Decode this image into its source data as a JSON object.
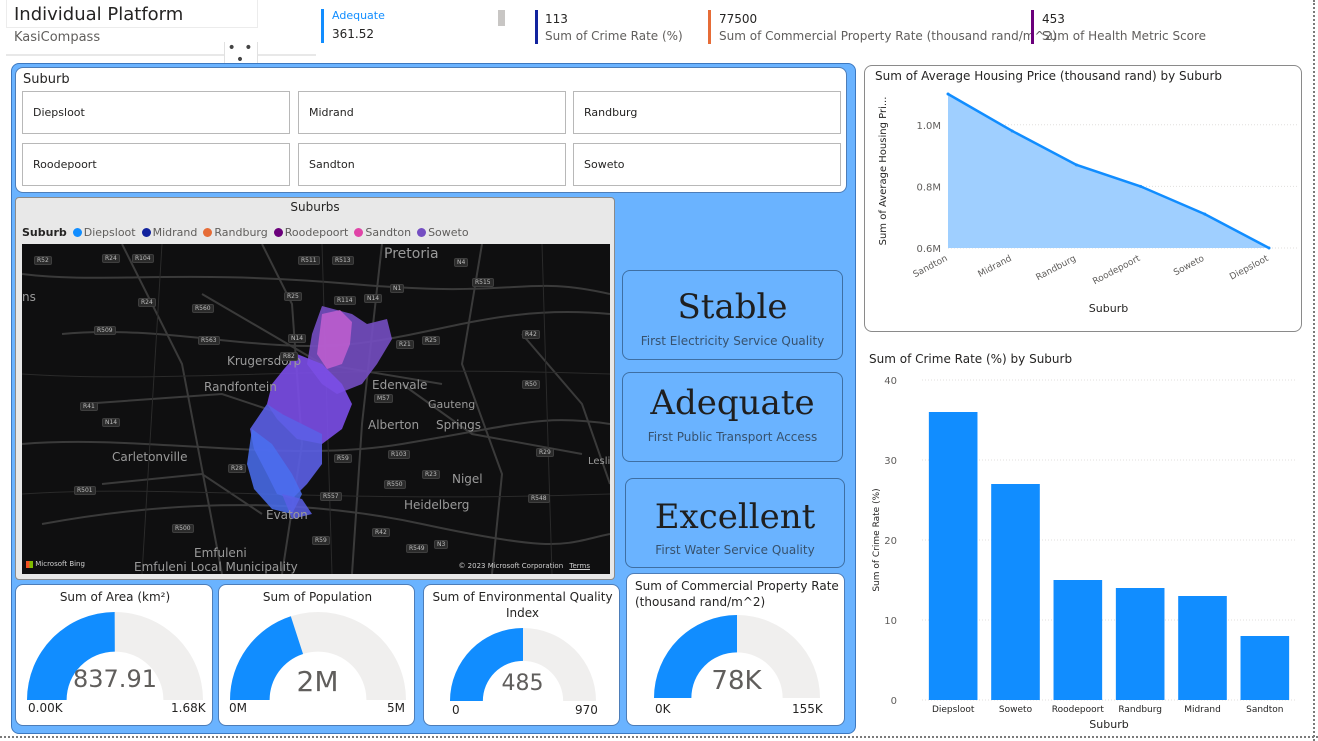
{
  "header": {
    "title": "Individual Platform",
    "subtitle": "KasiCompass",
    "more_glyph": "• • •"
  },
  "kpis": [
    {
      "value": "Adequate",
      "label": "361.52",
      "color": "#118dff"
    },
    {
      "value": "113",
      "label": "Sum of Crime Rate (%)",
      "color": "#12239e"
    },
    {
      "value": "77500",
      "label": "Sum of Commercial Property Rate (thousand rand/m^2)",
      "color": "#e66c37"
    },
    {
      "value": "453",
      "label": "Sum of Health Metric Score",
      "color": "#6b007b"
    }
  ],
  "slicer": {
    "title": "Suburb",
    "items": [
      "Diepsloot",
      "Midrand",
      "Randburg",
      "Roodepoort",
      "Sandton",
      "Soweto"
    ]
  },
  "map": {
    "title": "Suburbs",
    "legend_title": "Suburb",
    "legend": [
      {
        "name": "Diepsloot",
        "color": "#118dff"
      },
      {
        "name": "Midrand",
        "color": "#12239e"
      },
      {
        "name": "Randburg",
        "color": "#e66c37"
      },
      {
        "name": "Roodepoort",
        "color": "#6b007b"
      },
      {
        "name": "Sandton",
        "color": "#e044a7"
      },
      {
        "name": "Soweto",
        "color": "#744ec2"
      }
    ],
    "places": [
      "Pretoria",
      "Krugersdorp",
      "Randfontein",
      "Edenvale",
      "Alberton",
      "Springs",
      "Carletonville",
      "Nigel",
      "Evaton",
      "Heidelberg",
      "Emfuleni",
      "Emfuleni Local Municipality",
      "Gauteng",
      "Lesli",
      "ns"
    ],
    "roads": [
      "R52",
      "R24",
      "R104",
      "R511",
      "R513",
      "N4",
      "R25",
      "R24",
      "R560",
      "R114",
      "N14",
      "R515",
      "R42",
      "R509",
      "R563",
      "N14",
      "R21",
      "R25",
      "R41",
      "R50",
      "N14",
      "M57",
      "R59",
      "R28",
      "R103",
      "R29",
      "R501",
      "R550",
      "R23",
      "R548",
      "R500",
      "R557",
      "R42",
      "R59",
      "R549",
      "N3",
      "N1",
      "R82"
    ],
    "bing": "Microsoft Bing",
    "copyright": "© 2023 Microsoft Corporation",
    "terms": "Terms"
  },
  "cards": [
    {
      "value": "Stable",
      "label": "First Electricity Service Quality"
    },
    {
      "value": "Adequate",
      "label": "First Public Transport Access"
    },
    {
      "value": "Excellent",
      "label": "First Water Service Quality"
    }
  ],
  "gauges": [
    {
      "title": "Sum of Area (km²)",
      "value_label": "837.91",
      "min_label": "0.00K",
      "max_label": "1.68K",
      "value": 837.91,
      "min": 0,
      "max": 1680
    },
    {
      "title": "Sum of Population",
      "value_label": "2M",
      "min_label": "0M",
      "max_label": "5M",
      "value": 2,
      "min": 0,
      "max": 5
    },
    {
      "title": "Sum of Environmental Quality Index",
      "value_label": "485",
      "min_label": "0",
      "max_label": "970",
      "value": 485,
      "min": 0,
      "max": 970
    },
    {
      "title": "Sum of Commercial Property Rate (thousand rand/m^2)",
      "value_label": "78K",
      "min_label": "0K",
      "max_label": "155K",
      "value": 77.5,
      "min": 0,
      "max": 155
    }
  ],
  "colors": {
    "accent": "#118dff",
    "panel": "#6ab3ff",
    "gauge_track": "#f0efee"
  },
  "chart_data": [
    {
      "type": "area",
      "title": "Sum of Average Housing Price (thousand rand) by Suburb",
      "xlabel": "Suburb",
      "ylabel": "Sum of Average Housing Pri...",
      "categories": [
        "Sandton",
        "Midrand",
        "Randburg",
        "Roodepoort",
        "Soweto",
        "Diepsloot"
      ],
      "values": [
        1.1,
        0.98,
        0.87,
        0.8,
        0.71,
        0.6
      ],
      "ylim": [
        0.6,
        1.1
      ],
      "yticks": [
        0.6,
        0.8,
        1.0
      ],
      "ytick_labels": [
        "0.6M",
        "0.8M",
        "1.0M"
      ],
      "grid": true,
      "color": "#118dff"
    },
    {
      "type": "bar",
      "title": "Sum of Crime Rate (%) by Suburb",
      "xlabel": "Suburb",
      "ylabel": "Sum of Crime Rate (%)",
      "categories": [
        "Diepsloot",
        "Soweto",
        "Roodepoort",
        "Randburg",
        "Midrand",
        "Sandton"
      ],
      "values": [
        36,
        27,
        15,
        14,
        13,
        8
      ],
      "ylim": [
        0,
        40
      ],
      "yticks": [
        0,
        10,
        20,
        30,
        40
      ],
      "grid": true,
      "color": "#118dff"
    }
  ]
}
